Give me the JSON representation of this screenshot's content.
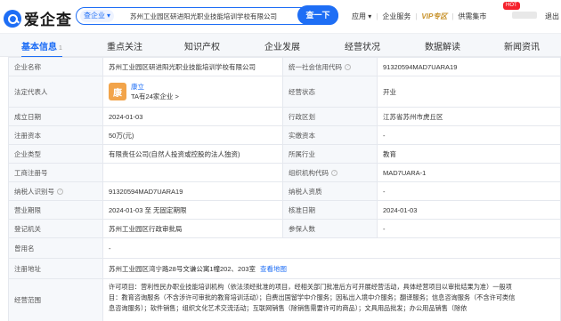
{
  "header": {
    "logo_text": "爱企查",
    "search_scope": "查企业",
    "search_value": "苏州工业园区研进阳光职业技能培训学校有限公司",
    "search_button": "查一下",
    "links": [
      "应用",
      "企业服务",
      "VIP专区",
      "供需集市"
    ],
    "hot_badge": "HOT",
    "logout": "退出"
  },
  "tabs": [
    {
      "label": "基本信息",
      "count": "1",
      "active": true
    },
    {
      "label": "重点关注",
      "count": "",
      "active": false
    },
    {
      "label": "知识产权",
      "count": "",
      "active": false
    },
    {
      "label": "企业发展",
      "count": "",
      "active": false
    },
    {
      "label": "经营状况",
      "count": "",
      "active": false
    },
    {
      "label": "数据解读",
      "count": "",
      "active": false
    },
    {
      "label": "新闻资讯",
      "count": "",
      "active": false
    }
  ],
  "info": {
    "company_name_label": "企业名称",
    "company_name": "苏州工业园区研进阳光职业技能培训学校有限公司",
    "credit_code_label": "统一社会信用代码",
    "credit_code": "91320594MAD7UARA19",
    "legal_rep_label": "法定代表人",
    "legal_avatar": "康",
    "legal_name": "康立",
    "legal_sub": "TA有24家企业 >",
    "status_label": "经营状态",
    "status": "开业",
    "founded_label": "成立日期",
    "founded": "2024-01-03",
    "region_label": "行政区划",
    "region": "江苏省苏州市虎丘区",
    "reg_capital_label": "注册资本",
    "reg_capital": "50万(元)",
    "paid_capital_label": "实缴资本",
    "paid_capital": "-",
    "company_type_label": "企业类型",
    "company_type": "有限责任公司(自然人投资或控股的法人独资)",
    "industry_label": "所属行业",
    "industry": "教育",
    "biz_reg_no_label": "工商注册号",
    "biz_reg_no": "",
    "org_code_label": "组织机构代码",
    "org_code": "MAD7UARA-1",
    "taxpayer_id_label": "纳税人识别号",
    "taxpayer_id": "91320594MAD7UARA19",
    "taxpayer_qual_label": "纳税人资质",
    "taxpayer_qual": "-",
    "term_label": "营业期限",
    "term": "2024-01-03 至 无固定期限",
    "approval_date_label": "核准日期",
    "approval_date": "2024-01-03",
    "authority_label": "登记机关",
    "authority": "苏州工业园区行政审批局",
    "insured_label": "参保人数",
    "insured": "-",
    "former_name_label": "曾用名",
    "former_name": "-",
    "address_label": "注册地址",
    "address": "苏州工业园区湾宁路28号文谦公寓1幢202、203室",
    "map_link": "查看地图",
    "scope_label": "经营范围",
    "scope_line1": "许可项目：营利性民办职业技能培训机构（依法须经批准的项目，经相关部门批准后方可开展经营活动，具体经营项目以审批结果为准）一般项",
    "scope_line2": "目：教育咨询服务（不含涉许可审批的教育培训活动）；自费出国留学中介服务；因私出入境中介服务；翻译服务；信息咨询服务（不含许可类信",
    "scope_line3": "息咨询服务）；软件销售；组织文化艺术交流活动；互联网销售（除销售需要许可的商品）；文具用品批发；办公用品销售（除依"
  },
  "colors": {
    "accent": "#1e6ef5",
    "vip": "#c8922a",
    "hot": "#f5222d",
    "avatar": "#f2a44a"
  }
}
